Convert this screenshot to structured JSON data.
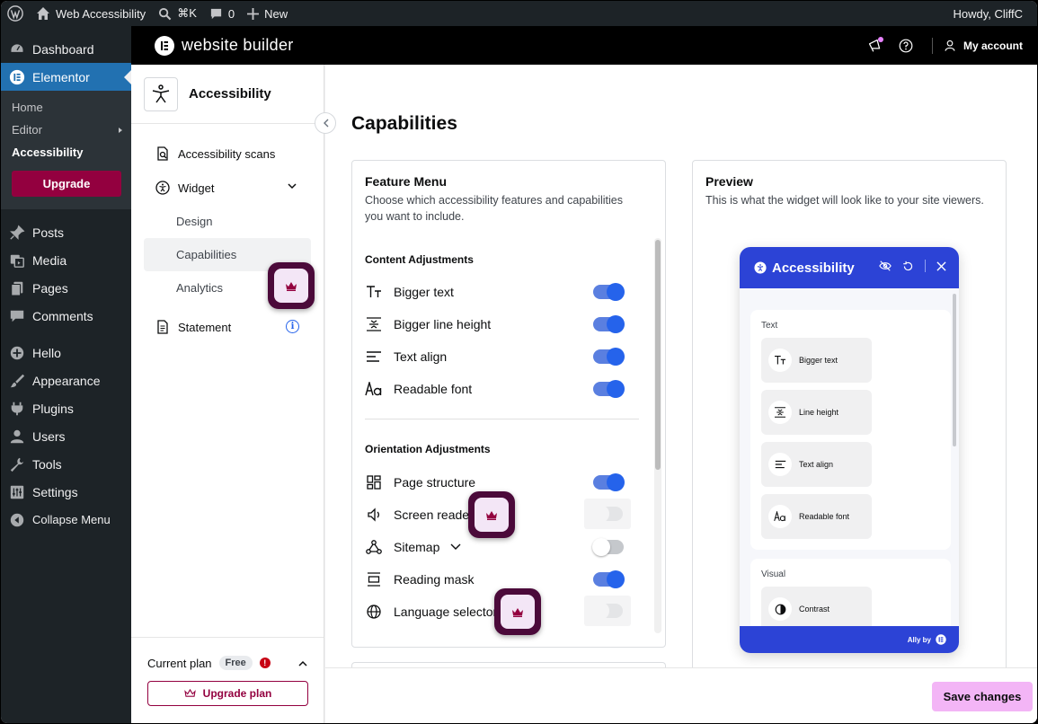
{
  "adminbar": {
    "site_name": "Web Accessibility",
    "shortcut": "⌘K",
    "comments_count": "0",
    "new_label": "New",
    "howdy": "Howdy, CliffC"
  },
  "wpmenu": {
    "dashboard": "Dashboard",
    "elementor": "Elementor",
    "sub_home": "Home",
    "sub_editor": "Editor",
    "sub_accessibility": "Accessibility",
    "upgrade": "Upgrade",
    "posts": "Posts",
    "media": "Media",
    "pages": "Pages",
    "comments": "Comments",
    "hello": "Hello",
    "appearance": "Appearance",
    "plugins": "Plugins",
    "users": "Users",
    "tools": "Tools",
    "settings": "Settings",
    "collapse": "Collapse Menu"
  },
  "etop": {
    "title": "website builder",
    "account": "My account"
  },
  "panel": {
    "title": "Accessibility",
    "scans": "Accessibility scans",
    "widget": "Widget",
    "design": "Design",
    "capabilities": "Capabilities",
    "analytics": "Analytics",
    "statement": "Statement",
    "current_plan": "Current plan",
    "plan_chip": "Free",
    "upgrade_plan": "Upgrade plan"
  },
  "main": {
    "title": "Capabilities",
    "feature_menu_title": "Feature Menu",
    "feature_menu_desc": "Choose which accessibility features and capabilities you want to include.",
    "content_section": "Content Adjustments",
    "content_features": [
      {
        "label": "Bigger text",
        "on": true
      },
      {
        "label": "Bigger line height",
        "on": true
      },
      {
        "label": "Text align",
        "on": true
      },
      {
        "label": "Readable font",
        "on": true
      }
    ],
    "orientation_section": "Orientation Adjustments",
    "orientation_features": [
      {
        "label": "Page structure",
        "on": true
      },
      {
        "label": "Screen reader",
        "on": false
      },
      {
        "label": "Sitemap",
        "on": false
      },
      {
        "label": "Reading mask",
        "on": true
      },
      {
        "label": "Language selector",
        "on": false
      }
    ],
    "preview_title": "Preview",
    "preview_desc": "This is what the widget will look like to your site viewers.",
    "save": "Save changes"
  },
  "widget": {
    "title": "Accessibility",
    "text_label": "Text",
    "tiles": [
      "Bigger text",
      "Line height",
      "Text align",
      "Readable font"
    ],
    "visual_label": "Visual",
    "visual_tiles": [
      "Contrast"
    ],
    "footer": "Ally by"
  },
  "colors": {
    "wp_blue": "#2271b1",
    "elementor_magenta": "#93003f",
    "toggle_blue": "#2563eb",
    "widget_blue": "#2c43d6",
    "save_pink": "#f3b5f6"
  }
}
